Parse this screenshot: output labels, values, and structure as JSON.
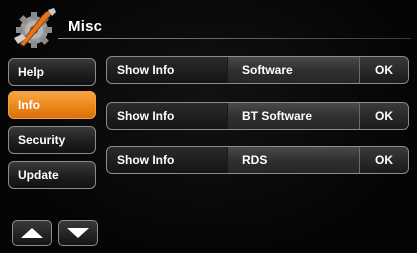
{
  "header": {
    "title": "Misc",
    "icon": "gear-wrench-icon"
  },
  "sidebar": {
    "items": [
      {
        "label": "Help",
        "active": false
      },
      {
        "label": "Info",
        "active": true
      },
      {
        "label": "Security",
        "active": false
      },
      {
        "label": "Update",
        "active": false
      }
    ],
    "scroll_up_icon": "arrow-up-icon",
    "scroll_down_icon": "arrow-down-icon"
  },
  "rows": [
    {
      "label": "Show Info",
      "value": "Software",
      "action": "OK"
    },
    {
      "label": "Show Info",
      "value": "BT Software",
      "action": "OK"
    },
    {
      "label": "Show Info",
      "value": "RDS",
      "action": "OK"
    }
  ],
  "colors": {
    "accent": "#ee8a1c",
    "background": "#050505",
    "text": "#ffffff"
  }
}
